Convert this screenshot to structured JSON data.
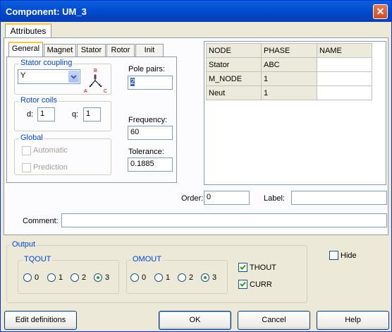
{
  "window": {
    "title": "Component: UM_3",
    "close_label": "✕"
  },
  "tabs": {
    "main": "Attributes"
  },
  "subtabs": [
    "General",
    "Magnet",
    "Stator",
    "Rotor",
    "Init"
  ],
  "stator_coupling": {
    "label": "Stator coupling",
    "value": "Y",
    "icon_letters": {
      "top": "B",
      "left": "A",
      "right": "C"
    }
  },
  "rotor_coils": {
    "label": "Rotor coils",
    "d_label": "d:",
    "d_value": "1",
    "q_label": "q:",
    "q_value": "1"
  },
  "global": {
    "label": "Global",
    "automatic_label": "Automatic",
    "prediction_label": "Prediction"
  },
  "pole_pairs": {
    "label": "Pole pairs:",
    "value": "2"
  },
  "frequency": {
    "label": "Frequency:",
    "value": "60"
  },
  "tolerance": {
    "label": "Tolerance:",
    "value": "0.1885"
  },
  "table": {
    "headers": [
      "NODE",
      "PHASE",
      "NAME"
    ],
    "rows": [
      [
        "Stator",
        "ABC",
        ""
      ],
      [
        "M_NODE",
        "1",
        ""
      ],
      [
        "Neut",
        "1",
        ""
      ]
    ]
  },
  "order": {
    "label": "Order:",
    "value": "0"
  },
  "label_field": {
    "label": "Label:",
    "value": ""
  },
  "comment": {
    "label": "Comment:",
    "value": ""
  },
  "output": {
    "label": "Output",
    "tqout": {
      "label": "TQOUT",
      "options": [
        "0",
        "1",
        "2",
        "3"
      ],
      "selected": "3"
    },
    "omout": {
      "label": "OMOUT",
      "options": [
        "0",
        "1",
        "2",
        "3"
      ],
      "selected": "3"
    },
    "thout_label": "THOUT",
    "thout_checked": true,
    "curr_label": "CURR",
    "curr_checked": true
  },
  "hide_label": "Hide",
  "buttons": {
    "edit": "Edit definitions",
    "ok": "OK",
    "cancel": "Cancel",
    "help": "Help"
  },
  "colors": {
    "title_bar": "#0453d6",
    "group_label": "#0046d5",
    "radio_dot": "#21a121"
  }
}
